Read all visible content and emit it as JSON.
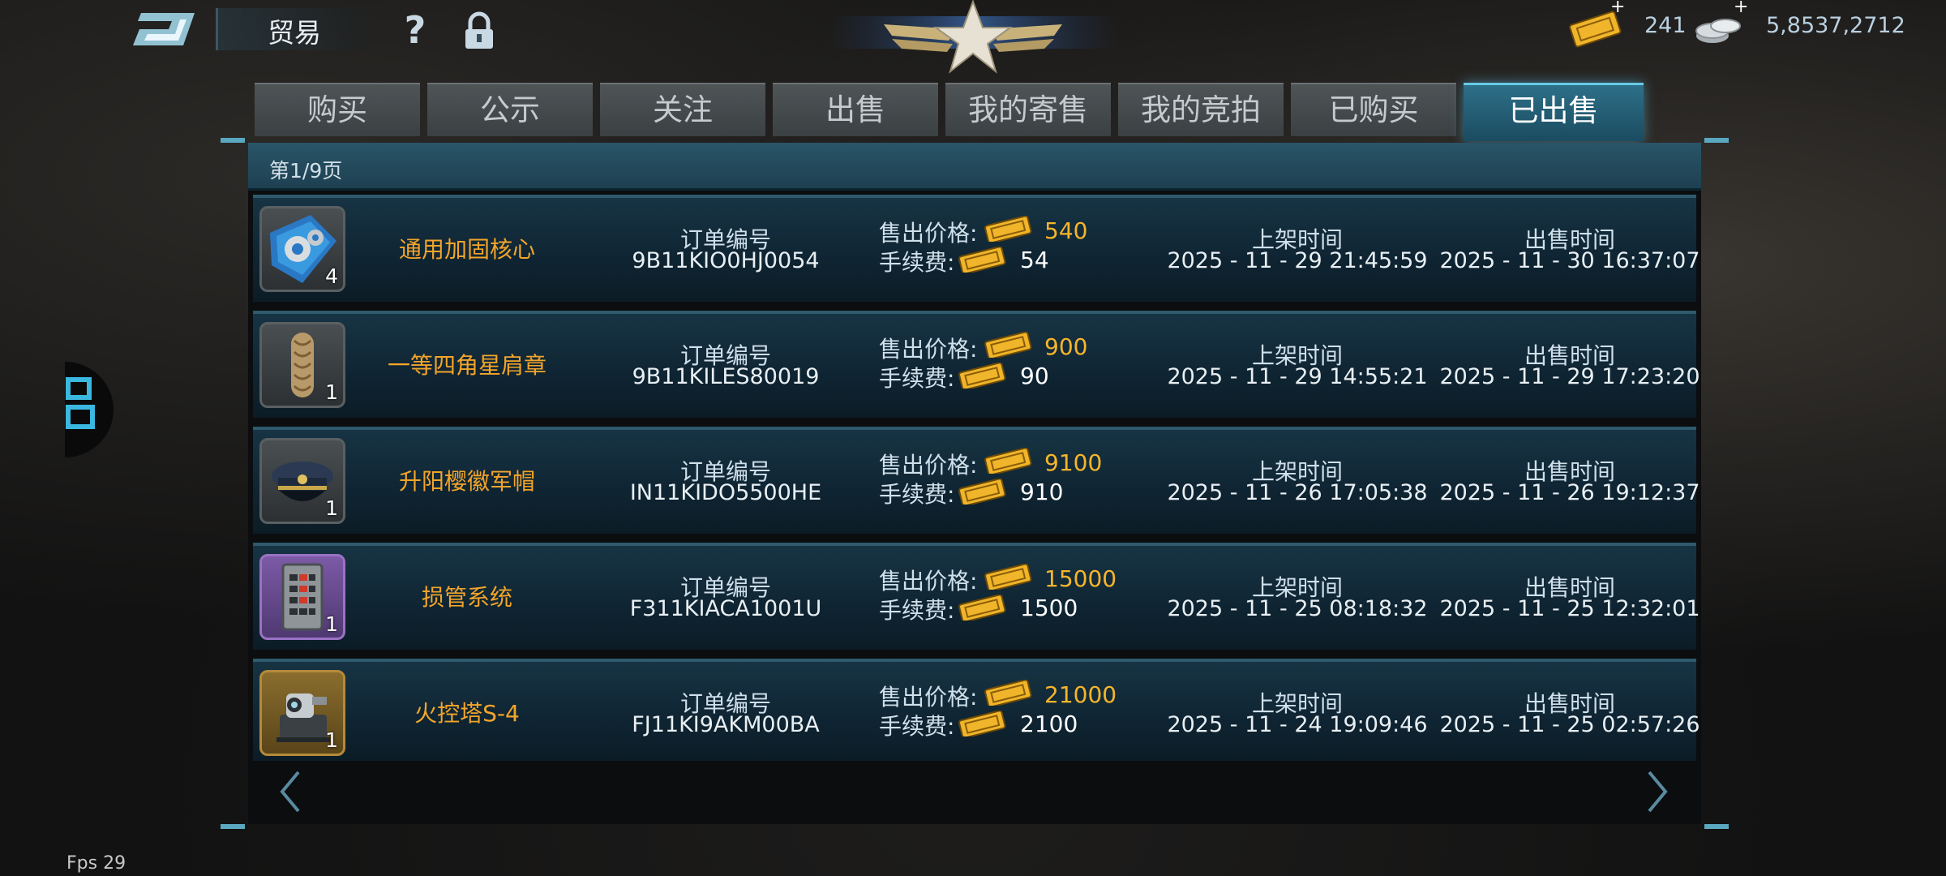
{
  "header": {
    "title": "贸易",
    "help_label": "?",
    "tickets_count": "241",
    "silver_count": "5,8537,2712",
    "plus_symbol": "+"
  },
  "tabs": [
    {
      "label": "购买",
      "active": false
    },
    {
      "label": "公示",
      "active": false
    },
    {
      "label": "关注",
      "active": false
    },
    {
      "label": "出售",
      "active": false
    },
    {
      "label": "我的寄售",
      "active": false
    },
    {
      "label": "我的竞拍",
      "active": false
    },
    {
      "label": "已购买",
      "active": false
    },
    {
      "label": "已出售",
      "active": true
    }
  ],
  "page_indicator": "第1/9页",
  "labels": {
    "order": "订单编号",
    "price": "售出价格:",
    "fee": "手续费:",
    "listed": "上架时间",
    "sold": "出售时间"
  },
  "rows": [
    {
      "name": "通用加固核心",
      "qty": "4",
      "order_id": "9B11KIO0HJ0054",
      "price": "540",
      "fee": "54",
      "listed": "2025 - 11 - 29 21:45:59",
      "sold": "2025 - 11 - 30 16:37:07",
      "icon": "gears-icon"
    },
    {
      "name": "一等四角星肩章",
      "qty": "1",
      "order_id": "9B11KILES80019",
      "price": "900",
      "fee": "90",
      "listed": "2025 - 11 - 29 14:55:21",
      "sold": "2025 - 11 - 29 17:23:20",
      "icon": "epaulette-icon"
    },
    {
      "name": "升阳樱徽军帽",
      "qty": "1",
      "order_id": "IN11KIDO5500HE",
      "price": "9100",
      "fee": "910",
      "listed": "2025 - 11 - 26 17:05:38",
      "sold": "2025 - 11 - 26 19:12:37",
      "icon": "military-cap-icon"
    },
    {
      "name": "损管系统",
      "qty": "1",
      "order_id": "F311KIACA1001U",
      "price": "15000",
      "fee": "1500",
      "listed": "2025 - 11 - 25 08:18:32",
      "sold": "2025 - 11 - 25 12:32:01",
      "icon": "control-panel-icon"
    },
    {
      "name": "火控塔S-4",
      "qty": "1",
      "order_id": "FJ11KI9AKM00BA",
      "price": "21000",
      "fee": "2100",
      "listed": "2025 - 11 - 24 19:09:46",
      "sold": "2025 - 11 - 25 02:57:26",
      "icon": "fire-control-tower-icon"
    }
  ],
  "fps": "Fps 29",
  "colors": {
    "accent": "#68c9e6",
    "price": "#f6b52a",
    "item_name": "#f3a52a"
  }
}
